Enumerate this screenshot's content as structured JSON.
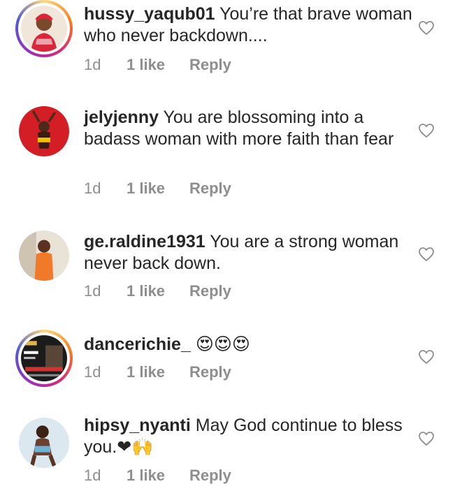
{
  "comments": [
    {
      "username": "hussy_yaqub01",
      "text": "You’re that brave woman who never backdown....",
      "time": "1d",
      "likes": "1 like",
      "reply": "Reply"
    },
    {
      "username": "jelyjenny",
      "text": "You are blossoming into a badass woman with more faith than fear",
      "time": "1d",
      "likes": "1 like",
      "reply": "Reply"
    },
    {
      "username": "ge.raldine1931",
      "text": "You are a strong woman never back down.",
      "time": "1d",
      "likes": "1 like",
      "reply": "Reply"
    },
    {
      "username": "dancerichie_",
      "text": "😍😍😍",
      "time": "1d",
      "likes": "1 like",
      "reply": "Reply"
    },
    {
      "username": "hipsy_nyanti",
      "text": "May God continue to bless you.❤🙌",
      "time": "1d",
      "likes": "1 like",
      "reply": "Reply"
    }
  ],
  "colors": {
    "username": "#262626",
    "meta": "#8e8e8e",
    "heart_outline": "#8e8e8e"
  },
  "icons": {
    "like": "heart-outline-icon"
  }
}
